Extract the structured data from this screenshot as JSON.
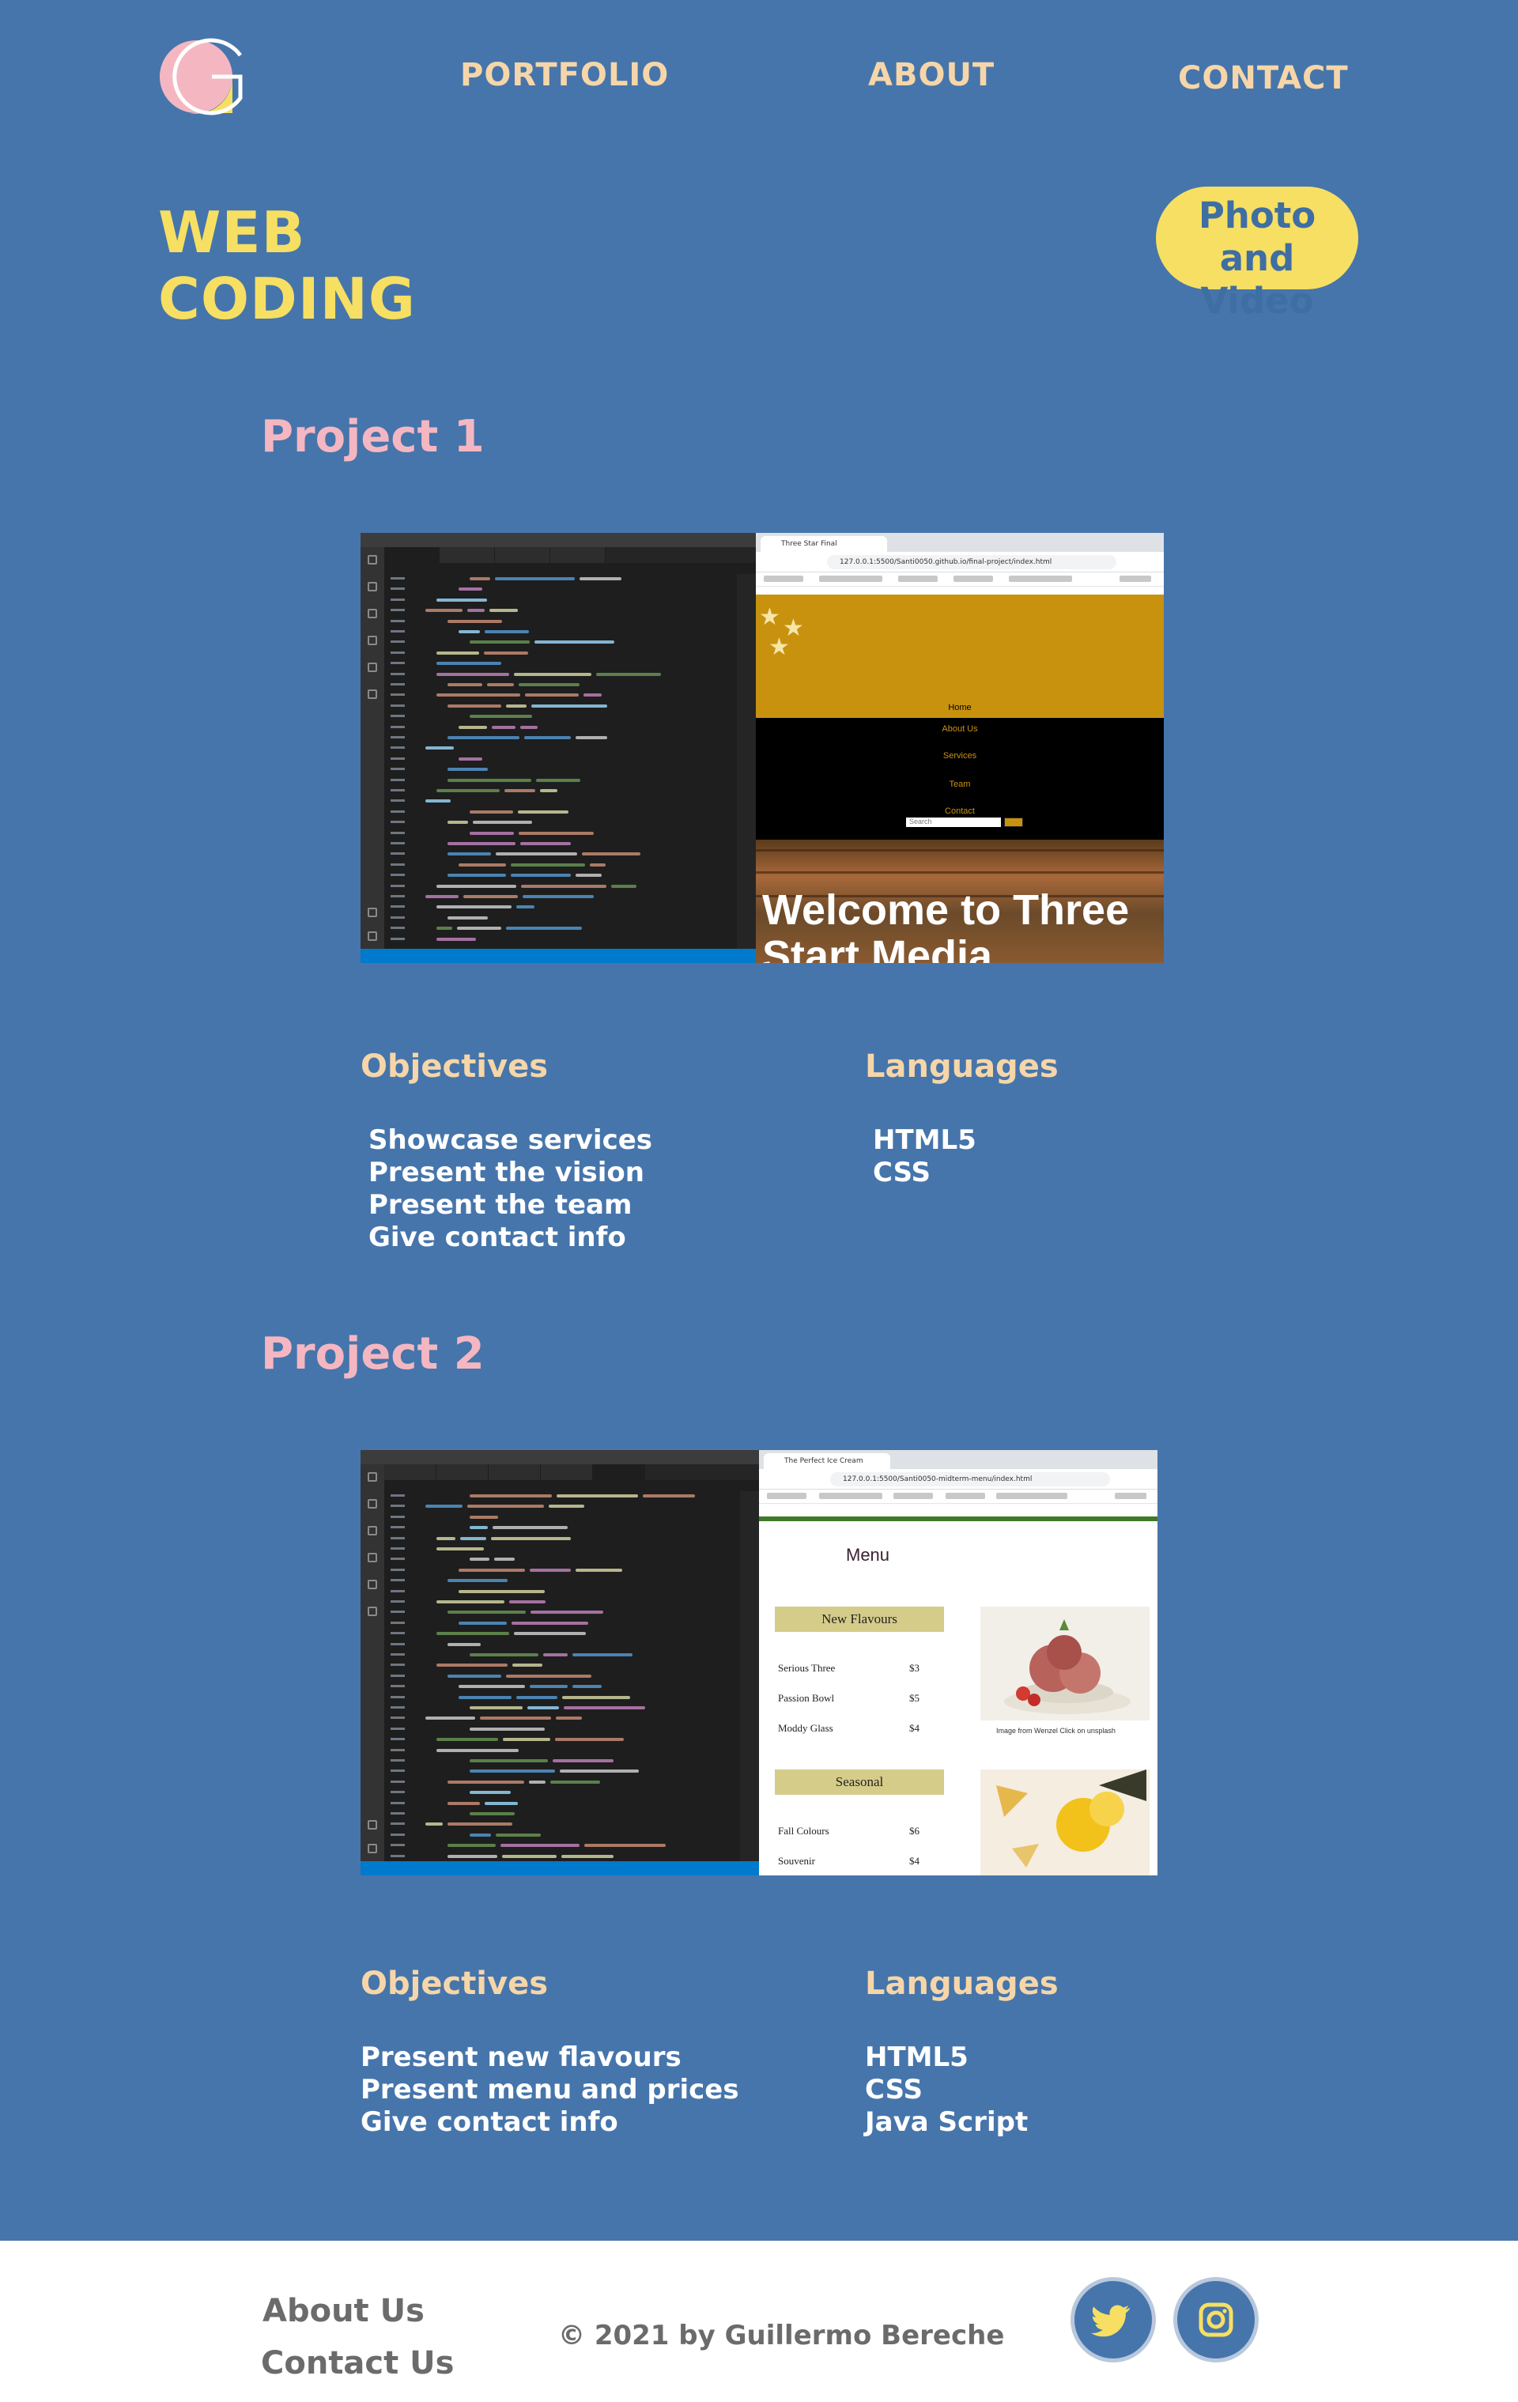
{
  "header": {
    "nav": [
      "PORTFOLIO",
      "ABOUT",
      "CONTACT"
    ],
    "title_line1": "WEB",
    "title_line2": "CODING",
    "photo_button_line1": "Photo and",
    "photo_button_line2": "Video"
  },
  "projects": [
    {
      "title": "Project 1",
      "screenshot": {
        "browser_tab": "Three Star Final",
        "address": "127.0.0.1:5500/Santi0050.github.io/final-project/index.html",
        "site_nav": [
          "Home",
          "About Us",
          "Services",
          "Team",
          "Contact"
        ],
        "search_placeholder": "Search",
        "hero_line1": "Welcome to Three",
        "hero_line2": "Start Media"
      },
      "objectives_heading": "Objectives",
      "objectives": [
        "Showcase services",
        "Present the vision",
        "Present the team",
        "Give contact info"
      ],
      "languages_heading": "Languages",
      "languages": [
        "HTML5",
        "CSS"
      ]
    },
    {
      "title": "Project 2",
      "screenshot": {
        "browser_tab": "The Perfect Ice Cream",
        "address": "127.0.0.1:5500/Santi0050-midterm-menu/index.html",
        "menu_title": "Menu",
        "category1": "New Flavours",
        "items1": [
          {
            "name": "Serious Three",
            "price": "$3"
          },
          {
            "name": "Passion Bowl",
            "price": "$5"
          },
          {
            "name": "Moddy Glass",
            "price": "$4"
          }
        ],
        "category2": "Seasonal",
        "items2": [
          {
            "name": "Fall Colours",
            "price": "$6"
          },
          {
            "name": "Souvenir",
            "price": "$4"
          }
        ],
        "image_caption": "Image from Wenzel Click on unsplash"
      },
      "objectives_heading": "Objectives",
      "objectives": [
        "Present new flavours",
        "Present menu and prices",
        "Give contact info"
      ],
      "languages_heading": "Languages",
      "languages": [
        "HTML5",
        "CSS",
        "Java Script"
      ]
    }
  ],
  "footer": {
    "links": [
      "About Us",
      "Contact Us"
    ],
    "copyright": "© 2021 by Guillermo Bereche",
    "social": [
      "twitter-icon",
      "instagram-icon"
    ]
  },
  "colors": {
    "background": "#4675ab",
    "accent_yellow": "#f6df62",
    "nav_peach": "#f6d6a8",
    "project_pink": "#f4b7c2",
    "footer_text": "#6b6b6b"
  }
}
